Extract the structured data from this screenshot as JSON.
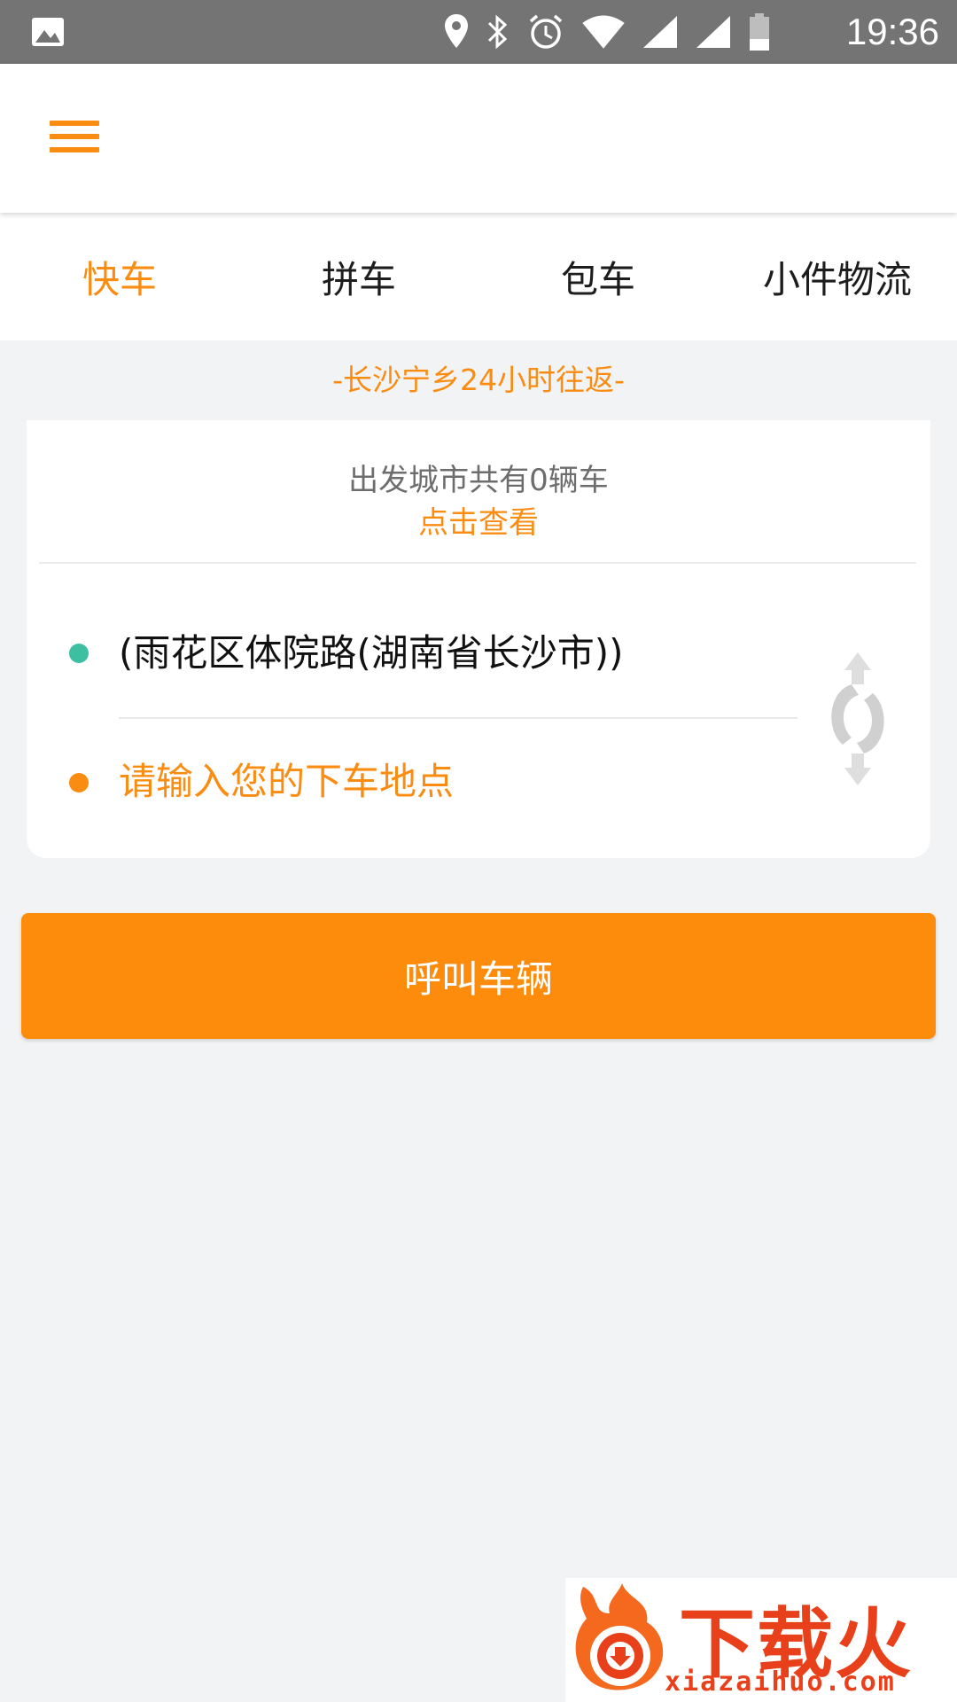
{
  "status_bar": {
    "time": "19:36",
    "icons": [
      "image-icon",
      "location-icon",
      "bluetooth-icon",
      "alarm-icon",
      "wifi-icon",
      "signal-icon",
      "signal-icon-2",
      "battery-icon"
    ]
  },
  "header": {
    "menu_icon": "hamburger-menu-icon"
  },
  "tabs": [
    {
      "label": "快车",
      "active": true
    },
    {
      "label": "拼车",
      "active": false
    },
    {
      "label": "包车",
      "active": false
    },
    {
      "label": "小件物流",
      "active": false
    }
  ],
  "route_slogan": "-长沙宁乡24小时往返-",
  "card": {
    "vehicle_count_text": "出发城市共有0辆车",
    "view_link": "点击查看",
    "start_location": "(雨花区体院路(湖南省长沙市))",
    "end_placeholder": "请输入您的下车地点",
    "swap_icon": "swap-direction-icon"
  },
  "call_button": "呼叫车辆",
  "watermark": {
    "brand": "下载火",
    "url": "xiazaihuo.com"
  },
  "colors": {
    "accent": "#fa8c12",
    "start_dot": "#3dbfa2",
    "status_bar": "#747474",
    "background": "#f2f3f5"
  }
}
